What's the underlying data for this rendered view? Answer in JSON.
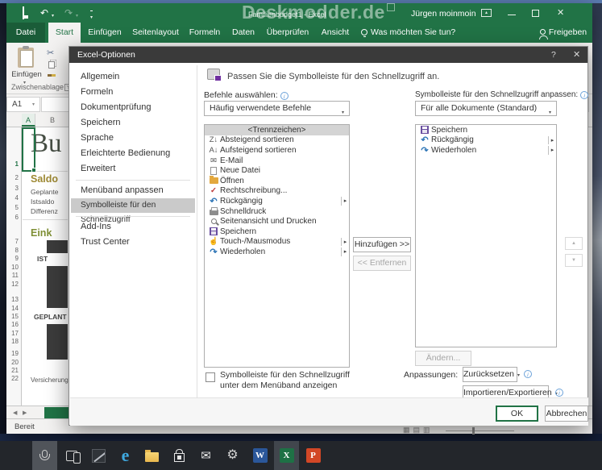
{
  "icons": {
    "close": "✕",
    "help": "?",
    "caret": "▾",
    "flyout": "▸",
    "info": "i",
    "undo": "↶",
    "redo": "↷",
    "email": "✉",
    "touch": "☝",
    "check": "✓",
    "sort_desc": "Z↓",
    "sort_asc": "A↓",
    "up": "▲",
    "down": "▼",
    "nav_left": "◀",
    "nav_right": "▶",
    "launcher": "↘",
    "rdo_arrow": "▴",
    "view_icons": "▦▤▥",
    "scissors": "✂",
    "mail_glyph": "✉",
    "gear_glyph": "⚙"
  },
  "desktop": {
    "watermark": "Deskmodder.de"
  },
  "excel": {
    "titlebar": {
      "title": "Familienbudget1 - Excel",
      "user": "Jürgen moinmoin"
    },
    "ribbon": {
      "tabs": [
        "Datei",
        "Start",
        "Einfügen",
        "Seitenlayout",
        "Formeln",
        "Daten",
        "Überprüfen",
        "Ansicht"
      ],
      "active_tab": "Start",
      "tellme": "Was möchten Sie tun?",
      "share": "Freigeben",
      "paste_label": "Einfügen",
      "group_label": "Zwischenablage"
    },
    "name_box": "A1",
    "columns": [
      "A",
      "B"
    ],
    "rows": [
      "1",
      "2",
      "3",
      "4",
      "5",
      "6",
      "7",
      "8",
      "9",
      "10",
      "11",
      "12",
      "13",
      "14",
      "15",
      "16",
      "17",
      "18",
      "19",
      "20",
      "21",
      "22"
    ],
    "sheet": {
      "title": "Bu",
      "heading1": "Saldo",
      "line1": "Geplante",
      "line2": "Istsaldo",
      "line3": "Differenz",
      "heading2": "Eink",
      "label_ist": "IST",
      "label_geplant": "GEPLANT",
      "label_versicherung": "Versicherung"
    },
    "status": "Bereit"
  },
  "dialog": {
    "title": "Excel-Optionen",
    "sidebar": {
      "items": [
        "Allgemein",
        "Formeln",
        "Dokumentprüfung",
        "Speichern",
        "Sprache",
        "Erleichterte Bedienung",
        "Erweitert",
        "Menüband anpassen",
        "Symbolleiste für den Schnellzugriff",
        "Add-Ins",
        "Trust Center"
      ],
      "selected": "Symbolleiste für den Schnellzugriff"
    },
    "header": "Passen Sie die Symbolleiste für den Schnellzugriff an.",
    "choose_commands_label": "Befehle auswählen:",
    "choose_commands_value": "Häufig verwendete Befehle",
    "customize_label": "Symbolleiste für den Schnellzugriff anpassen:",
    "customize_value": "Für alle Dokumente (Standard)",
    "commands": [
      {
        "label": "<Trennzeichen>"
      },
      {
        "label": "Absteigend sortieren"
      },
      {
        "label": "Aufsteigend sortieren"
      },
      {
        "label": "E-Mail"
      },
      {
        "label": "Neue Datei"
      },
      {
        "label": "Öffnen"
      },
      {
        "label": "Rechtschreibung..."
      },
      {
        "label": "Rückgängig"
      },
      {
        "label": "Schnelldruck"
      },
      {
        "label": "Seitenansicht und Drucken"
      },
      {
        "label": "Speichern"
      },
      {
        "label": "Touch-/Mausmodus"
      },
      {
        "label": "Wiederholen"
      }
    ],
    "qat_items": [
      {
        "label": "Speichern"
      },
      {
        "label": "Rückgängig"
      },
      {
        "label": "Wiederholen"
      }
    ],
    "buttons": {
      "add": "Hinzufügen >>",
      "remove": "<< Entfernen",
      "modify": "Ändern...",
      "reset": "Zurücksetzen",
      "import_export": "Importieren/Exportieren",
      "ok": "OK",
      "cancel": "Abbrechen"
    },
    "customizations_label": "Anpassungen:",
    "checkbox_label": "Symbolleiste für den Schnellzugriff unter dem Menüband anzeigen"
  },
  "taskbar": {
    "items": [
      "cortana-microphone",
      "task-view",
      "pen-app",
      "edge",
      "file-explorer",
      "store",
      "mail",
      "settings",
      "word",
      "excel",
      "powerpoint"
    ],
    "word_glyph": "W",
    "excel_glyph": "X",
    "powerpoint_glyph": "P",
    "edge_glyph": "e"
  }
}
